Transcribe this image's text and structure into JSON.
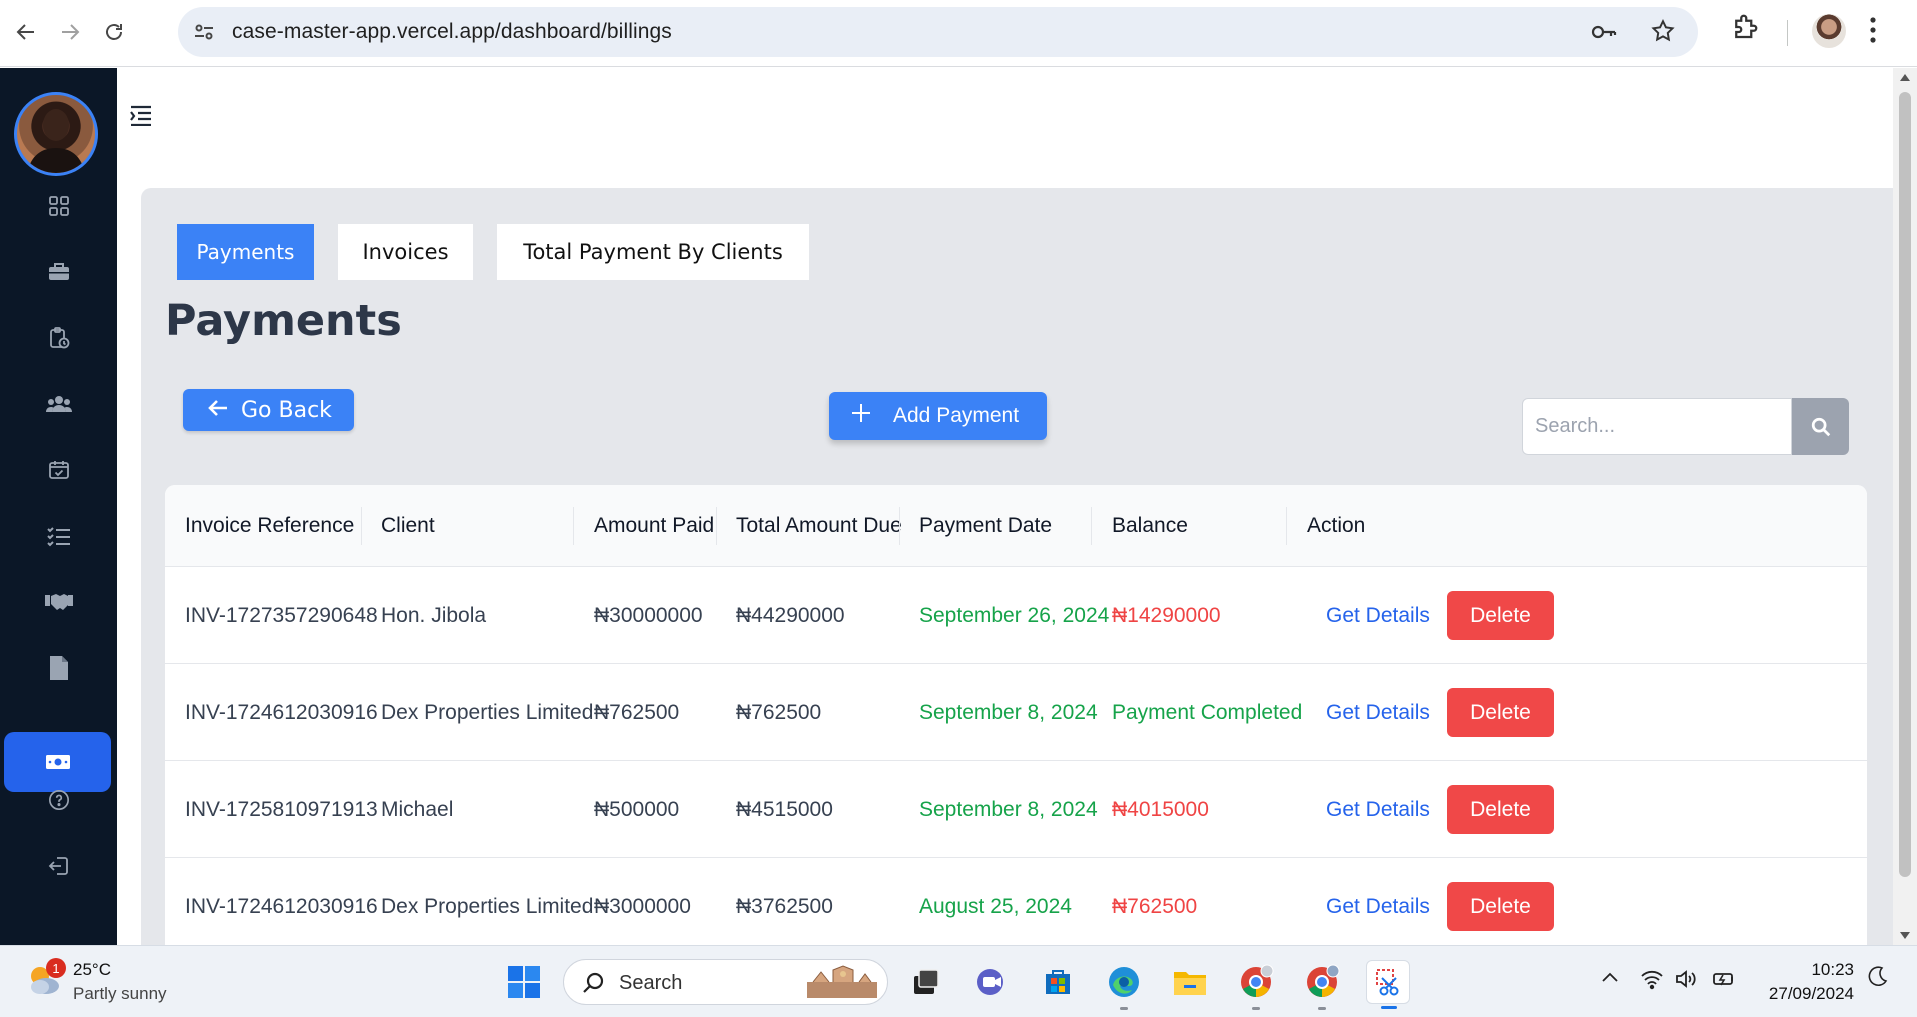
{
  "browser": {
    "url": "case-master-app.vercel.app/dashboard/billings"
  },
  "tabs": [
    {
      "label": "Payments",
      "active": true
    },
    {
      "label": "Invoices",
      "active": false
    },
    {
      "label": "Total Payment By Clients",
      "active": false
    }
  ],
  "page_title": "Payments",
  "buttons": {
    "go_back": "Go Back",
    "add_payment": "Add Payment"
  },
  "search": {
    "placeholder": "Search...",
    "value": ""
  },
  "table": {
    "headers": [
      "Invoice Reference",
      "Client",
      "Amount Paid",
      "Total Amount Due",
      "Payment Date",
      "Balance",
      "Action"
    ],
    "rows": [
      {
        "ref": "INV-1727357290648",
        "client": "Hon. Jibola",
        "paid": "₦30000000",
        "due": "₦44290000",
        "date": "September 26, 2024",
        "balance": "₦14290000",
        "balance_status": "outstanding",
        "details": "Get Details",
        "delete": "Delete"
      },
      {
        "ref": "INV-1724612030916",
        "client": "Dex Properties Limited",
        "paid": "₦762500",
        "due": "₦762500",
        "date": "September 8, 2024",
        "balance": "Payment Completed",
        "balance_status": "completed",
        "details": "Get Details",
        "delete": "Delete"
      },
      {
        "ref": "INV-1725810971913",
        "client": "Michael",
        "paid": "₦500000",
        "due": "₦4515000",
        "date": "September 8, 2024",
        "balance": "₦4015000",
        "balance_status": "outstanding",
        "details": "Get Details",
        "delete": "Delete"
      },
      {
        "ref": "INV-1724612030916",
        "client": "Dex Properties Limited",
        "paid": "₦3000000",
        "due": "₦3762500",
        "date": "August 25, 2024",
        "balance": "₦762500",
        "balance_status": "outstanding",
        "details": "Get Details",
        "delete": "Delete"
      }
    ]
  },
  "sidebar": {
    "items": [
      {
        "icon": "grid-icon"
      },
      {
        "icon": "briefcase-icon"
      },
      {
        "icon": "clipboard-clock-icon"
      },
      {
        "icon": "users-icon"
      },
      {
        "icon": "calendar-check-icon"
      },
      {
        "icon": "task-list-icon"
      },
      {
        "icon": "handshake-icon"
      },
      {
        "icon": "document-icon"
      },
      {
        "icon": "money-icon",
        "active": true
      },
      {
        "icon": "help-icon"
      },
      {
        "icon": "logout-icon"
      }
    ]
  },
  "taskbar": {
    "weather_badge": "1",
    "temperature": "25°C",
    "condition": "Partly sunny",
    "search_label": "Search",
    "time": "10:23",
    "date": "27/09/2024"
  },
  "colors": {
    "primary": "#3b82f6",
    "sidebar": "#0b1727",
    "danger": "#f04848",
    "success": "#16a34a",
    "panel": "#e5e7eb"
  }
}
